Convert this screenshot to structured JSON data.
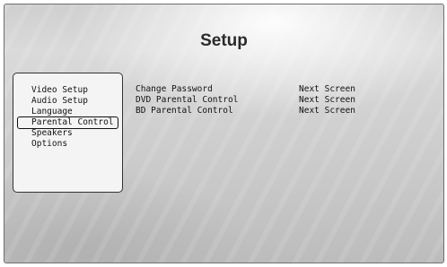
{
  "screen": {
    "title": "Setup"
  },
  "menu": {
    "items": [
      {
        "label": "Video Setup"
      },
      {
        "label": "Audio Setup"
      },
      {
        "label": "Language"
      },
      {
        "label": "Parental Control",
        "selected": true
      },
      {
        "label": "Speakers"
      },
      {
        "label": "Options"
      }
    ]
  },
  "detail": {
    "rows": [
      {
        "name": "Change Password",
        "value": "Next Screen"
      },
      {
        "name": "DVD Parental Control",
        "value": "Next Screen"
      },
      {
        "name": "BD Parental Control",
        "value": "Next Screen"
      }
    ]
  },
  "colors": {
    "background": "#cfcfcf",
    "panel": "#f4f4f4",
    "text": "#111111"
  }
}
